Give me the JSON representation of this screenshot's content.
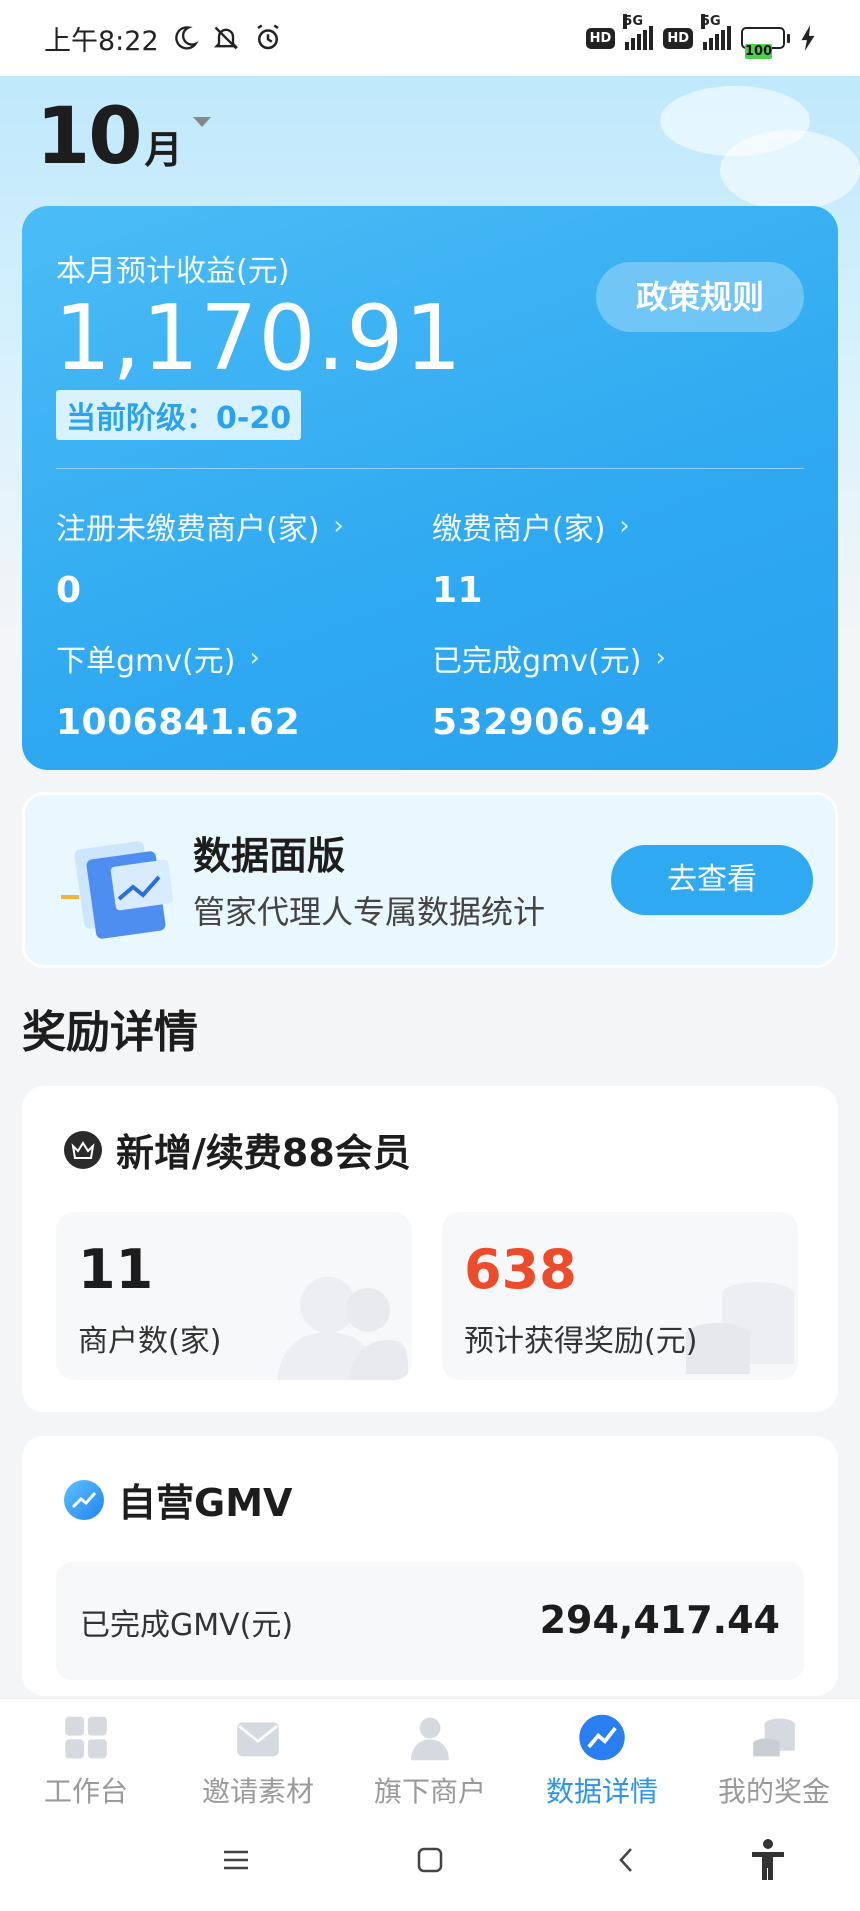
{
  "status_bar": {
    "time": "上午8:22",
    "battery": "100",
    "network_1": "5G",
    "network_2": "5G",
    "hd_1": "HD",
    "hd_2": "HD"
  },
  "header": {
    "month_number": "10",
    "month_unit": "月"
  },
  "earnings": {
    "label": "本月预计收益(元)",
    "amount": "1,170.91",
    "tier": "当前阶级：0-20",
    "policy_button": "政策规则",
    "stats": [
      {
        "label": "注册未缴费商户(家)",
        "value": "0"
      },
      {
        "label": "缴费商户(家)",
        "value": "11"
      },
      {
        "label": "下单gmv(元)",
        "value": "1006841.62"
      },
      {
        "label": "已完成gmv(元)",
        "value": "532906.94"
      }
    ]
  },
  "data_panel": {
    "title": "数据面版",
    "subtitle": "管家代理人专属数据统计",
    "button": "去查看"
  },
  "rewards": {
    "section_title": "奖励详情",
    "membership_card": {
      "title": "新增/续费88会员",
      "merchant_count": "11",
      "merchant_label": "商户数(家)",
      "reward_value": "638",
      "reward_label": "预计获得奖励(元)",
      "reward_color": "#ee4b2b"
    },
    "gmv_card": {
      "title": "自营GMV",
      "row_label": "已完成GMV(元)",
      "row_value": "294,417.44"
    }
  },
  "tabs": [
    {
      "label": "工作台",
      "icon": "grid-icon",
      "active": false
    },
    {
      "label": "邀请素材",
      "icon": "envelope-icon",
      "active": false
    },
    {
      "label": "旗下商户",
      "icon": "person-icon",
      "active": false
    },
    {
      "label": "数据详情",
      "icon": "trend-icon",
      "active": true
    },
    {
      "label": "我的奖金",
      "icon": "coins-icon",
      "active": false
    }
  ],
  "colors": {
    "accent": "#2fa9f1",
    "active_tab": "#2a95ea"
  }
}
